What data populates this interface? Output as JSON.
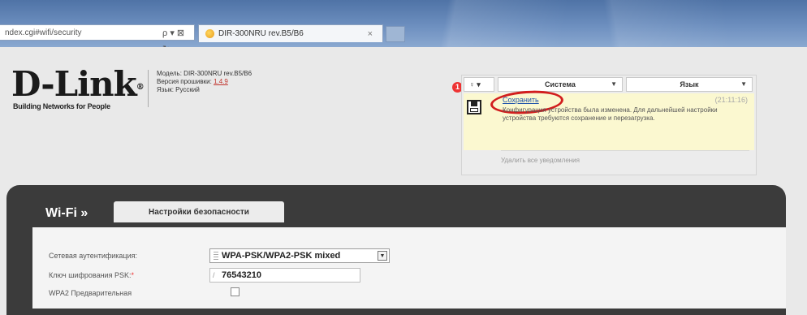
{
  "browser": {
    "address": "ndex.cgi#wifi/security",
    "address_icons": "ρ ▾ ⊠ ↻",
    "tab_title": "DIR-300NRU rev.B5/B6",
    "tab_close": "×"
  },
  "header": {
    "logo": "D-Link",
    "logo_mark": "®",
    "tagline": "Building Networks for People",
    "model_line": "Модель: DIR-300NRU rev.B5/B6",
    "firmware_label": "Версия прошивки:",
    "firmware_value": "1.4.9",
    "language_line": "Язык: Русский"
  },
  "notifications": {
    "badge": "1",
    "bulb_icon_text": "♀ ▾",
    "system_menu": "Система",
    "language_menu": "Язык",
    "save_link": "Сохранить",
    "time": "(21:11:16)",
    "message": "Конфигурация устройства была изменена. Для дальнейшей настройки устройства требуются сохранение и перезагрузка.",
    "clear_all": "Удалить все уведомления"
  },
  "main": {
    "section_title": "Wi-Fi »",
    "subtab": "Настройки безопасности",
    "auth_label": "Сетевая аутентификация:",
    "auth_value": "WPA-PSK/WPA2-PSK mixed",
    "psk_label": "Ключ шифрования PSK:",
    "psk_required": "*",
    "psk_value": "76543210",
    "wpa2_label": "WPA2 Предварительная"
  },
  "colors": {
    "chrome": "#5a7db0",
    "panel_dark": "#3b3b3b",
    "notif_bg": "#fbf8d0",
    "highlight_circle": "#d21e1e",
    "badge": "#ee3333"
  }
}
